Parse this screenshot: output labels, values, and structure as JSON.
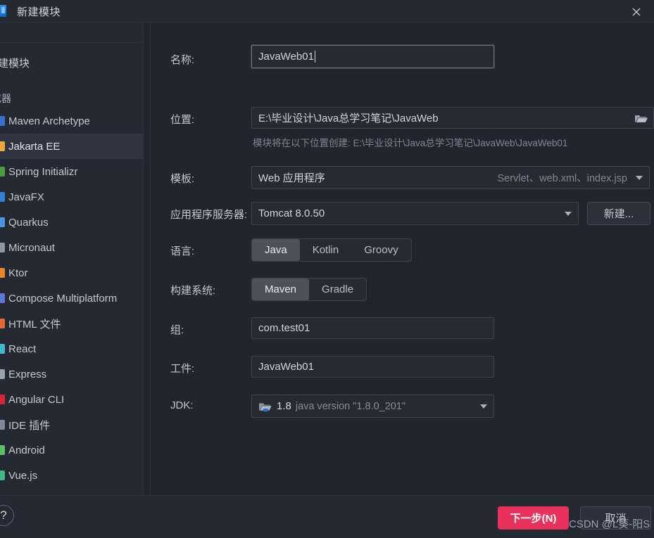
{
  "window": {
    "title": "新建模块",
    "app_icon": "intellij-module-icon",
    "close_icon": "close-icon"
  },
  "sidebar": {
    "new_module_label": "新建模块",
    "section_label": "生成器",
    "selected": "Jakarta EE",
    "items": [
      {
        "label": "Maven Archetype",
        "icon": "maven-icon",
        "color": "#3b6fd4"
      },
      {
        "label": "Jakarta EE",
        "icon": "jakarta-icon",
        "color": "#f0a73a"
      },
      {
        "label": "Spring Initializr",
        "icon": "spring-icon",
        "color": "#4f9c3f"
      },
      {
        "label": "JavaFX",
        "icon": "javafx-icon",
        "color": "#2f7fd6"
      },
      {
        "label": "Quarkus",
        "icon": "quarkus-icon",
        "color": "#4a95e0"
      },
      {
        "label": "Micronaut",
        "icon": "micronaut-icon",
        "color": "#8b94a3"
      },
      {
        "label": "Ktor",
        "icon": "ktor-icon",
        "color": "#e8852a"
      },
      {
        "label": "Compose Multiplatform",
        "icon": "compose-icon",
        "color": "#5a78d8"
      },
      {
        "label": "HTML 文件",
        "icon": "html-file-icon",
        "color": "#e06a32"
      },
      {
        "label": "React",
        "icon": "react-icon",
        "color": "#3fb5d1"
      },
      {
        "label": "Express",
        "icon": "express-icon",
        "color": "#9aa2ae"
      },
      {
        "label": "Angular CLI",
        "icon": "angular-icon",
        "color": "#d8213a"
      },
      {
        "label": "IDE 插件",
        "icon": "ide-plugin-icon",
        "color": "#7f8896"
      },
      {
        "label": "Android",
        "icon": "android-icon",
        "color": "#5fbf63"
      },
      {
        "label": "Vue.js",
        "icon": "vuejs-icon",
        "color": "#41b883"
      }
    ]
  },
  "form": {
    "name": {
      "label": "名称:",
      "value": "JavaWeb01",
      "placeholder": ""
    },
    "location": {
      "label": "位置:",
      "value": "E:\\毕业设计\\Java总学习笔记\\JavaWeb",
      "browse_icon": "folder-open-icon",
      "hint": "模块将在以下位置创建: E:\\毕业设计\\Java总学习笔记\\JavaWeb\\JavaWeb01"
    },
    "template": {
      "label": "模板:",
      "value": "Web 应用程序",
      "detail": "Servlet、web.xml、index.jsp",
      "dropdown_icon": "chevron-down-icon"
    },
    "app_server": {
      "label": "应用程序服务器:",
      "value": "Tomcat 8.0.50",
      "dropdown_icon": "chevron-down-icon",
      "new_button": "新建..."
    },
    "language": {
      "label": "语言:",
      "options": [
        "Java",
        "Kotlin",
        "Groovy"
      ],
      "selected": "Java"
    },
    "build_system": {
      "label": "构建系统:",
      "options": [
        "Maven",
        "Gradle"
      ],
      "selected": "Maven"
    },
    "group": {
      "label": "组:",
      "value": "com.test01"
    },
    "artifact": {
      "label": "工件:",
      "value": "JavaWeb01"
    },
    "jdk": {
      "label": "JDK:",
      "icon": "jdk-folder-icon",
      "version": "1.8",
      "detail": "java version \"1.8.0_201\"",
      "dropdown_icon": "chevron-down-icon"
    }
  },
  "footer": {
    "help_label": "?",
    "next_label": "下一步(N)",
    "cancel_label": "取消",
    "watermark": "CSDN @L葵-阳S"
  },
  "colors": {
    "accent_next": "#e8315b",
    "background": "#21262e",
    "panel": "#242a33",
    "selection": "#2e3540"
  }
}
